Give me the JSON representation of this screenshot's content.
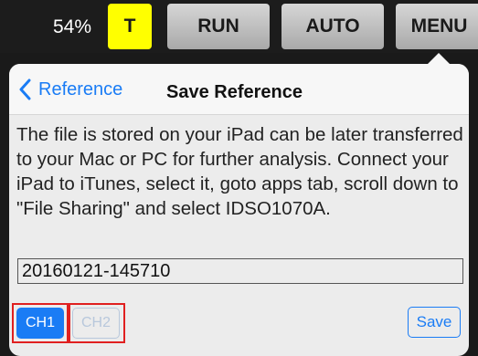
{
  "toolbar": {
    "percent": "54%",
    "t_label": "T",
    "run_label": "RUN",
    "auto_label": "AUTO",
    "menu_label": "MENU"
  },
  "popover": {
    "back_label": "Reference",
    "title": "Save Reference",
    "description": "The file is stored on your iPad can be later transferred to your Mac or PC for further analysis. Connect your iPad  to iTunes, select it, goto apps tab, scroll down to \"File Sharing\" and select IDSO1070A.",
    "filename_value": "20160121-145710",
    "ch1_label": "CH1",
    "ch2_label": "CH2",
    "save_label": "Save"
  },
  "colors": {
    "accent": "#1a7cf5",
    "t_button": "#ffff00",
    "highlight": "#e02020"
  },
  "icons": {
    "back": "chevron-left-icon"
  }
}
